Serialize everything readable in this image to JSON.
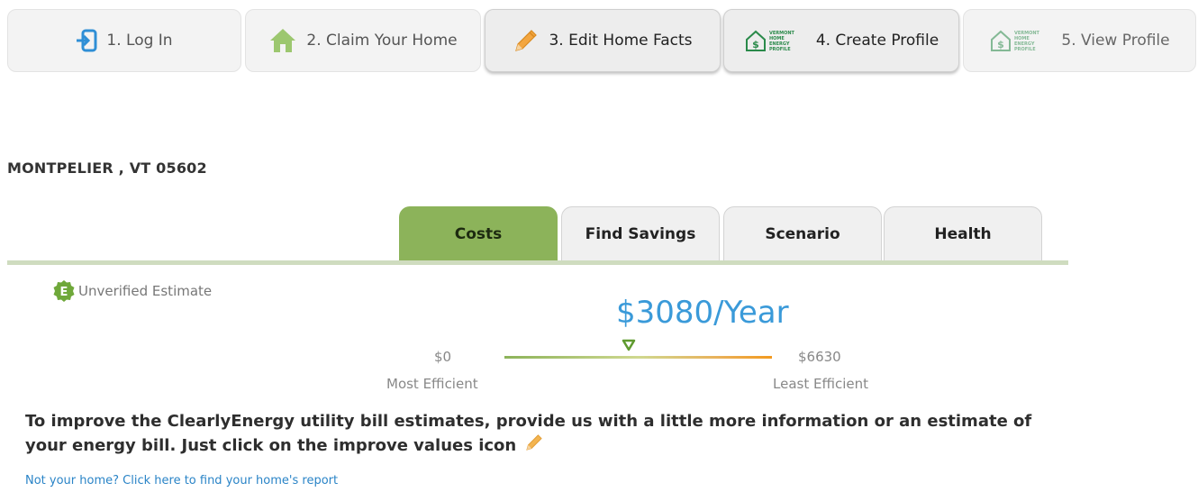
{
  "steps": [
    {
      "label": "1. Log In",
      "icon": "login-icon"
    },
    {
      "label": "2. Claim Your Home",
      "icon": "home-icon"
    },
    {
      "label": "3. Edit Home Facts",
      "icon": "pencil-icon"
    },
    {
      "label": "4. Create Profile",
      "icon": "vermont-energy-profile-logo-icon"
    },
    {
      "label": "5. View Profile",
      "icon": "vermont-energy-profile-logo-icon"
    }
  ],
  "logo_text": [
    "VERMONT",
    "HOME",
    "ENERGY",
    "PROFILE"
  ],
  "address": "MONTPELIER , VT 05602",
  "tabs": [
    {
      "label": "Costs",
      "active": true
    },
    {
      "label": "Find Savings"
    },
    {
      "label": "Scenario"
    },
    {
      "label": "Health"
    }
  ],
  "estimate": {
    "letter": "E",
    "label": "Unverified Estimate"
  },
  "cost": {
    "value_text": "$3080/Year",
    "min_label": "$0",
    "max_label": "$6630",
    "min_caption": "Most Efficient",
    "max_caption": "Least Efficient",
    "value": 3080,
    "min": 0,
    "max": 6630
  },
  "info_text": "To improve the ClearlyEnergy utility bill estimates, provide us with a little more information or an estimate of your energy bill. Just click on the improve values icon",
  "link_text": "Not your home? Click here to find your home's report",
  "colors": {
    "accent_green": "#8cb35a",
    "cost_blue": "#3a9ad9",
    "link_blue": "#2a84c7",
    "pencil_orange": "#f0a030"
  }
}
